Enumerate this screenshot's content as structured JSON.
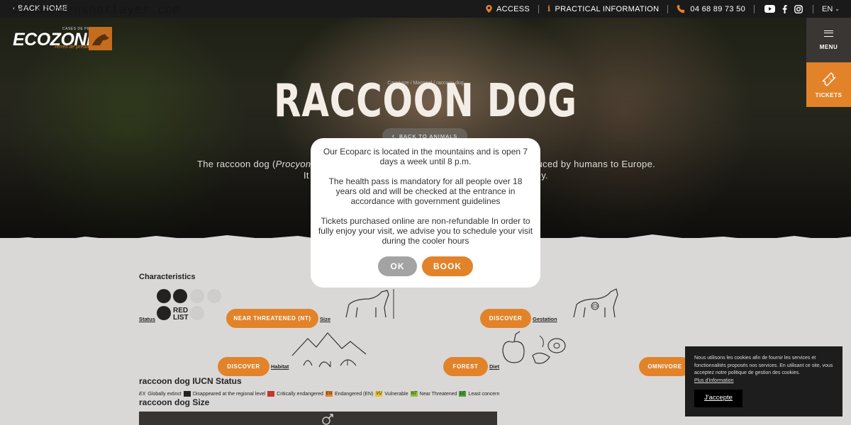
{
  "watermark": "by screenshotlayer.com",
  "topbar": {
    "back_home": "BACK HOME",
    "access": "ACCESS",
    "practical": "PRACTICAL INFORMATION",
    "phone": "04 68 89 73 50",
    "lang": "EN"
  },
  "logo": {
    "word": "ECOZONIA",
    "small": "CASES DE PENE 66",
    "sub": "Terres de prédateurs"
  },
  "side": {
    "menu": "MENU",
    "tickets": "TICKETS"
  },
  "hero": {
    "breadcrumb": "Carnivore / Mammal / raccoon dog",
    "title": "RACCOON DOG",
    "back_animals": "BACK TO ANIMALS",
    "intro_line1_left": "The raccoon dog (",
    "intro_line1_italic": "Procyonoides",
    "intro_line1_right": "duced by humans to Europe.",
    "intro_line2_left": "It",
    "intro_line2_right": "ly."
  },
  "characteristics": {
    "title": "Characteristics",
    "status_label": "Status",
    "status_value": "NEAR THREATENED (NT)",
    "size_label": "Size",
    "size_button": "DISCOVER",
    "gestation_label": "Gestation",
    "gestation_button": "DISCOVER",
    "habitat_label": "Habitat",
    "habitat_value": "FOREST",
    "diet_label": "Diet",
    "diet_value": "OMNIVORE",
    "redlist_text": "RED LIST"
  },
  "iucn": {
    "title": "raccoon dog IUCN Status",
    "legend": [
      {
        "code": "EX",
        "label": "Globally extinct",
        "color": ""
      },
      {
        "code": "",
        "label": "Disappeared at the regional level",
        "color": "#222222"
      },
      {
        "code": "",
        "label": "Critically endangered",
        "color": "#c0392b"
      },
      {
        "code": "EN",
        "label": "Endangered (EN)",
        "color": "#e2832a"
      },
      {
        "code": "VU",
        "label": "Vulnerable",
        "color": "#e6c22a"
      },
      {
        "code": "NT",
        "label": "Near Threatened",
        "color": "#8bbd3c"
      },
      {
        "code": "LC",
        "label": "Least concern",
        "color": "#4f9a3a"
      }
    ]
  },
  "size_section": {
    "title": "raccoon dog Size"
  },
  "modal": {
    "p1": "Our Ecoparc is located in the mountains and is open 7 days a week until 8 p.m.",
    "p2": "The health pass is mandatory for all people over 18 years old and will be checked at the entrance in accordance with government guidelines",
    "p3": "Tickets purchased online are non-refundable In order to fully enjoy your visit, we advise you to schedule your visit during the cooler hours",
    "ok": "OK",
    "book": "BOOK"
  },
  "cookie": {
    "text": "Nous utilisons les cookies afin de fournir les services et fonctionnalités proposés nos services. En utilisant ce site, vous acceptez notre politique de gestion des cookies.",
    "more": "Plus d'information",
    "accept": "J'accepte"
  },
  "colors": {
    "accent": "#e2832a",
    "dark": "#1a1a1a",
    "paper": "#d9d8d6"
  }
}
